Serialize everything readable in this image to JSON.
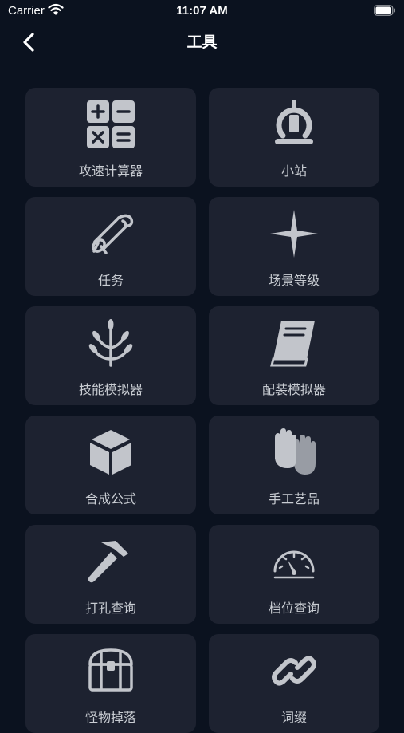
{
  "status_bar": {
    "carrier": "Carrier",
    "time": "11:07 AM"
  },
  "nav": {
    "title": "工具"
  },
  "tools": [
    {
      "label": "攻速计算器",
      "icon": "calculator-icon"
    },
    {
      "label": "小站",
      "icon": "station-icon"
    },
    {
      "label": "任务",
      "icon": "scroll-icon"
    },
    {
      "label": "场景等级",
      "icon": "star-icon"
    },
    {
      "label": "技能模拟器",
      "icon": "skill-tree-icon"
    },
    {
      "label": "配装模拟器",
      "icon": "book-icon"
    },
    {
      "label": "合成公式",
      "icon": "cube-icon"
    },
    {
      "label": "手工艺品",
      "icon": "gloves-icon"
    },
    {
      "label": "打孔查询",
      "icon": "hammer-icon"
    },
    {
      "label": "档位查询",
      "icon": "gauge-icon"
    },
    {
      "label": "怪物掉落",
      "icon": "chest-icon"
    },
    {
      "label": "词缀",
      "icon": "link-icon"
    }
  ],
  "colors": {
    "background": "#0b121f",
    "tile": "#1d2230",
    "icon": "#c2c5cb",
    "text": "#c9cdd3"
  }
}
